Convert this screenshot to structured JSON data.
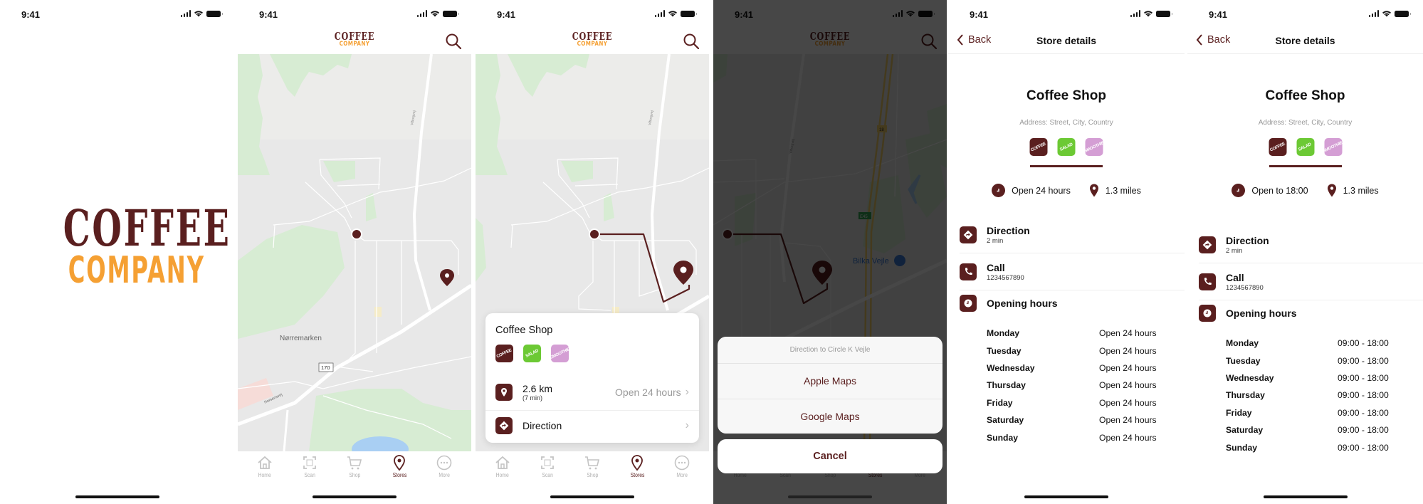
{
  "status_bar": {
    "time": "9:41"
  },
  "brand": {
    "line1": "COFFEE",
    "line2": "COMPANY",
    "primary_color": "#5a1f1f",
    "accent_color": "#f5a033"
  },
  "header": {
    "search_icon": "search-icon"
  },
  "map": {
    "road_label_1": "Viborgvej",
    "area_label": "Nørremarken",
    "route_shield": "170",
    "road_label_2": "Horsensvej",
    "highway_label_1": "18",
    "highway_label_2": "E45",
    "poi_label": "Bilka Vejle"
  },
  "tabbar": {
    "items": [
      {
        "label": "Home",
        "icon": "home-icon",
        "active": false
      },
      {
        "label": "Scan",
        "icon": "scan-icon",
        "active": false
      },
      {
        "label": "Shop",
        "icon": "cart-icon",
        "active": false
      },
      {
        "label": "Stores",
        "icon": "location-pin-icon",
        "active": true
      },
      {
        "label": "More",
        "icon": "more-icon",
        "active": false
      }
    ]
  },
  "store_card": {
    "name": "Coffee Shop",
    "tags": [
      {
        "label": "COFFEE",
        "color": "#5a1f1f"
      },
      {
        "label": "SALAD",
        "color": "#6cc934"
      },
      {
        "label": "SMOOTHIE",
        "color": "#d49ed4"
      }
    ],
    "distance": "2.6 km",
    "duration": "(7 min)",
    "hours_status": "Open 24 hours",
    "direction_label": "Direction"
  },
  "action_sheet": {
    "title": "Direction to Circle K Vejle",
    "options": [
      "Apple Maps",
      "Google Maps"
    ],
    "cancel_label": "Cancel"
  },
  "detail_nav": {
    "back_label": "Back",
    "title": "Store details"
  },
  "store_detail_a": {
    "name": "Coffee Shop",
    "address": "Address: Street, City, Country",
    "open_status": "Open 24 hours",
    "distance": "1.3 miles",
    "direction_label": "Direction",
    "direction_sub": "2 min",
    "call_label": "Call",
    "phone": "1234567890",
    "hours_label": "Opening hours",
    "hours": [
      {
        "day": "Monday",
        "value": "Open 24 hours"
      },
      {
        "day": "Tuesday",
        "value": "Open 24 hours"
      },
      {
        "day": "Wednesday",
        "value": "Open 24 hours"
      },
      {
        "day": "Thursday",
        "value": "Open 24 hours"
      },
      {
        "day": "Friday",
        "value": "Open 24 hours"
      },
      {
        "day": "Saturday",
        "value": "Open 24 hours"
      },
      {
        "day": "Sunday",
        "value": "Open 24 hours"
      }
    ]
  },
  "store_detail_b": {
    "name": "Coffee Shop",
    "address": "Address: Street, City, Country",
    "open_status": "Open to 18:00",
    "distance": "1.3 miles",
    "direction_label": "Direction",
    "direction_sub": "2 min",
    "call_label": "Call",
    "phone": "1234567890",
    "hours_label": "Opening hours",
    "hours": [
      {
        "day": "Monday",
        "value": "09:00 - 18:00"
      },
      {
        "day": "Tuesday",
        "value": "09:00 - 18:00"
      },
      {
        "day": "Wednesday",
        "value": "09:00 - 18:00"
      },
      {
        "day": "Thursday",
        "value": "09:00 - 18:00"
      },
      {
        "day": "Friday",
        "value": "09:00 - 18:00"
      },
      {
        "day": "Saturday",
        "value": "09:00 - 18:00"
      },
      {
        "day": "Sunday",
        "value": "09:00 - 18:00"
      }
    ]
  }
}
